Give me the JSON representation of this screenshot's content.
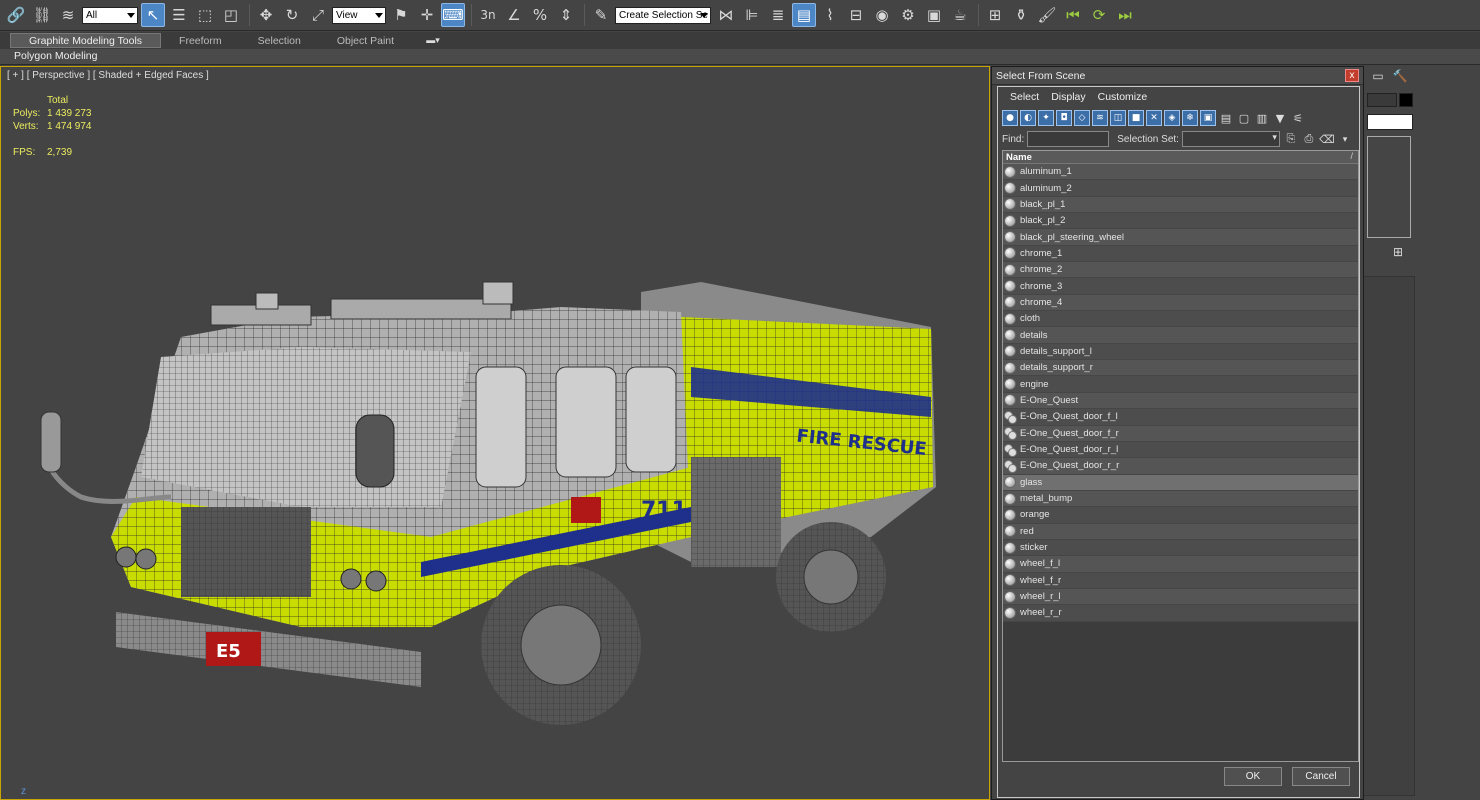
{
  "toolbar": {
    "filter_value": "All",
    "ref_coord_value": "View",
    "selection_set_value": "Create Selection Se",
    "snap_angle_label": "3n"
  },
  "ribbon": {
    "tabs": [
      "Graphite Modeling Tools",
      "Freeform",
      "Selection",
      "Object Paint"
    ],
    "panel": "Polygon Modeling"
  },
  "viewport": {
    "label": "[ + ] [ Perspective ] [ Shaded + Edged Faces ]",
    "stats": {
      "total_label": "Total",
      "polys_label": "Polys:",
      "polys_value": "1 439 273",
      "verts_label": "Verts:",
      "verts_value": "1 474 974",
      "fps_label": "FPS:",
      "fps_value": "2,739"
    },
    "truck_text": {
      "decal": "FIRE RESCUE",
      "number": "711",
      "plate": "E5"
    },
    "axis": "z"
  },
  "dialog": {
    "title": "Select From Scene",
    "close": "x",
    "menu": [
      "Select",
      "Display",
      "Customize"
    ],
    "find_label": "Find:",
    "selection_set_label": "Selection Set:",
    "column_header": "Name",
    "sort_indicator": "/",
    "objects": [
      {
        "name": "aluminum_1",
        "icon": "geometry-icon"
      },
      {
        "name": "aluminum_2",
        "icon": "geometry-icon"
      },
      {
        "name": "black_pl_1",
        "icon": "geometry-icon"
      },
      {
        "name": "black_pl_2",
        "icon": "geometry-icon"
      },
      {
        "name": "black_pl_steering_wheel",
        "icon": "geometry-icon"
      },
      {
        "name": "chrome_1",
        "icon": "geometry-icon"
      },
      {
        "name": "chrome_2",
        "icon": "geometry-icon"
      },
      {
        "name": "chrome_3",
        "icon": "geometry-icon"
      },
      {
        "name": "chrome_4",
        "icon": "geometry-icon"
      },
      {
        "name": "cloth",
        "icon": "geometry-icon"
      },
      {
        "name": "details",
        "icon": "geometry-icon"
      },
      {
        "name": "details_support_l",
        "icon": "geometry-icon"
      },
      {
        "name": "details_support_r",
        "icon": "geometry-icon"
      },
      {
        "name": "engine",
        "icon": "geometry-icon"
      },
      {
        "name": "E-One_Quest",
        "icon": "geometry-icon"
      },
      {
        "name": "E-One_Quest_door_f_l",
        "icon": "group-icon"
      },
      {
        "name": "E-One_Quest_door_f_r",
        "icon": "group-icon"
      },
      {
        "name": "E-One_Quest_door_r_l",
        "icon": "group-icon"
      },
      {
        "name": "E-One_Quest_door_r_r",
        "icon": "group-icon"
      },
      {
        "name": "glass",
        "icon": "geometry-icon",
        "selected": true
      },
      {
        "name": "metal_bump",
        "icon": "geometry-icon"
      },
      {
        "name": "orange",
        "icon": "geometry-icon"
      },
      {
        "name": "red",
        "icon": "geometry-icon"
      },
      {
        "name": "sticker",
        "icon": "geometry-icon"
      },
      {
        "name": "wheel_f_l",
        "icon": "geometry-icon"
      },
      {
        "name": "wheel_f_r",
        "icon": "geometry-icon"
      },
      {
        "name": "wheel_r_l",
        "icon": "geometry-icon"
      },
      {
        "name": "wheel_r_r",
        "icon": "geometry-icon"
      }
    ],
    "ok_label": "OK",
    "cancel_label": "Cancel"
  },
  "colors": {
    "accent_blue": "#4d86c5",
    "viewport_border": "#c8a400",
    "stats_text": "#ecec60",
    "truck_yellow": "#c8dc00",
    "truck_blue": "#1e2f8c",
    "truck_red": "#b01818",
    "close_red": "#c43c2c"
  }
}
